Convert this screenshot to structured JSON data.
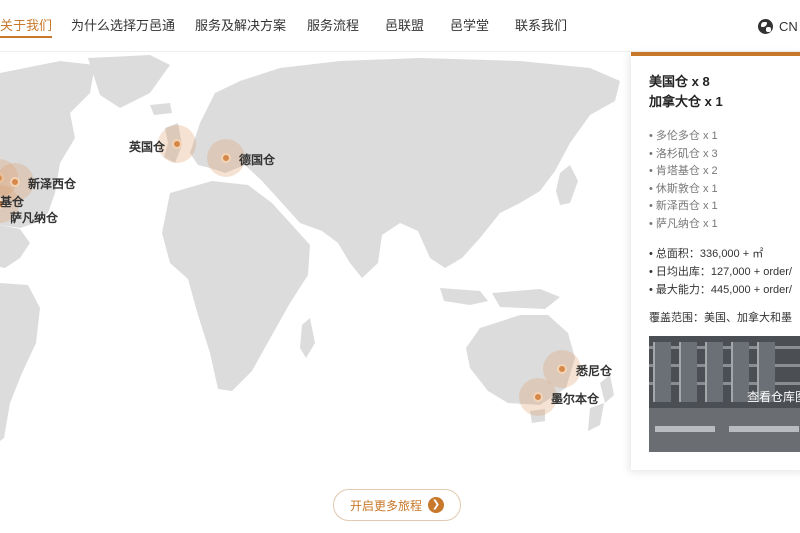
{
  "nav": {
    "items": [
      {
        "label": "关于我们",
        "active": true
      },
      {
        "label": "为什么选择万邑通",
        "active": false
      },
      {
        "label": "服务及解决方案",
        "active": false
      },
      {
        "label": "服务流程",
        "active": false
      },
      {
        "label": "邑联盟",
        "active": false
      },
      {
        "label": "邑学堂",
        "active": false
      },
      {
        "label": "联系我们",
        "active": false
      }
    ],
    "lang": "CN",
    "lang_icon": "globe-icon"
  },
  "map": {
    "land_color": "#dcdcdc",
    "accent": "#c8782a",
    "markers": [
      {
        "label": "新泽西仓"
      },
      {
        "label": "肯塔基仓"
      },
      {
        "label": "萨凡纳仓"
      },
      {
        "label": "英国仓"
      },
      {
        "label": "德国仓"
      },
      {
        "label": "悉尼仓"
      },
      {
        "label": "墨尔本仓"
      }
    ]
  },
  "panel": {
    "title1": "美国仓 x 8",
    "title2": "加拿大仓 x 1",
    "warehouses": [
      "• 多伦多仓 x 1",
      "• 洛杉矶仓 x 3",
      "• 肯塔基仓 x 2",
      "• 休斯敦仓 x 1",
      "• 新泽西仓 x 1",
      "• 萨凡纳仓 x 1"
    ],
    "stats": [
      "• 总面积：336,000 + ㎡",
      "• 日均出库：127,000 + order/",
      "• 最大能力：445,000 + order/"
    ],
    "coverage": "覆盖范围：美国、加拿大和墨",
    "photo_caption": "查看仓库图"
  },
  "cta": {
    "label": "开启更多旅程",
    "icon": "arrow-right-icon",
    "arrow_glyph": "❯"
  }
}
